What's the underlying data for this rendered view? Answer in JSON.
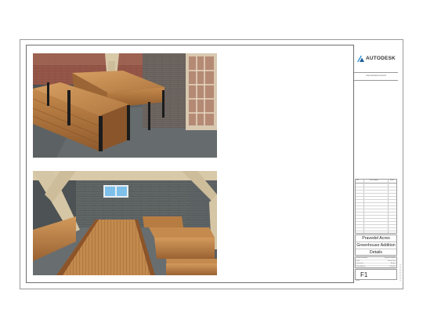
{
  "titleblock": {
    "logo_text": "AUTODESK",
    "subtitle": "www.autodesk.com/revit",
    "revision_headers": [
      "No.",
      "Description",
      "Date"
    ],
    "project_name": "Pravedel Acres",
    "project_title_line2": "Greenhouse Addition",
    "drawing_name": "Details",
    "fields": [
      {
        "label": "Project number",
        "value": "Project Number"
      },
      {
        "label": "Date",
        "value": "Issue Date"
      },
      {
        "label": "Drawn by",
        "value": "Author"
      },
      {
        "label": "Checked by",
        "value": "Checker"
      }
    ],
    "sheet_number": "F1",
    "scale_label": "Scale"
  },
  "colors": {
    "sheet_border": "#6f6f6f",
    "wood": "#b07840",
    "floor": "#5f6466",
    "wall_block": "#6c6560",
    "beam": "#d8c9a8",
    "logo_accent": "#2a8fd6"
  },
  "views": [
    {
      "id": "view-top",
      "description_icon": "rendered-3d-view"
    },
    {
      "id": "view-bottom",
      "description_icon": "rendered-3d-view"
    }
  ]
}
